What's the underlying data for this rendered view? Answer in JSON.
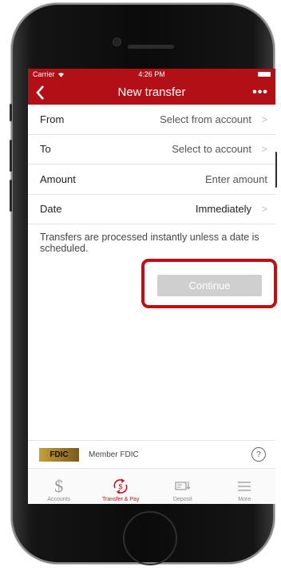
{
  "status_bar": {
    "carrier": "Carrier",
    "time": "4:26 PM"
  },
  "nav": {
    "title": "New transfer",
    "back_icon": "chevron-left-icon",
    "more_label": "•••"
  },
  "form": {
    "rows": [
      {
        "label": "From",
        "value": "Select from account",
        "chevron": true
      },
      {
        "label": "To",
        "value": "Select to account",
        "chevron": true
      },
      {
        "label": "Amount",
        "value": "Enter amount",
        "chevron": false
      },
      {
        "label": "Date",
        "value": "Immediately",
        "chevron": true
      }
    ],
    "note": "Transfers are processed instantly unless a date is scheduled.",
    "continue_label": "Continue"
  },
  "footer": {
    "fdic_logo": "FDIC",
    "member_text": "Member FDIC",
    "help_label": "?"
  },
  "tabs": [
    {
      "label": "Accounts",
      "icon": "dollar-icon",
      "active": false
    },
    {
      "label": "Transfer & Pay",
      "icon": "transfer-pay-icon",
      "active": true
    },
    {
      "label": "Deposit",
      "icon": "deposit-check-icon",
      "active": false
    },
    {
      "label": "More",
      "icon": "menu-icon",
      "active": false
    }
  ],
  "colors": {
    "brand": "#b30f16",
    "highlight": "#c20d14",
    "button_disabled": "#cfcfcf"
  }
}
